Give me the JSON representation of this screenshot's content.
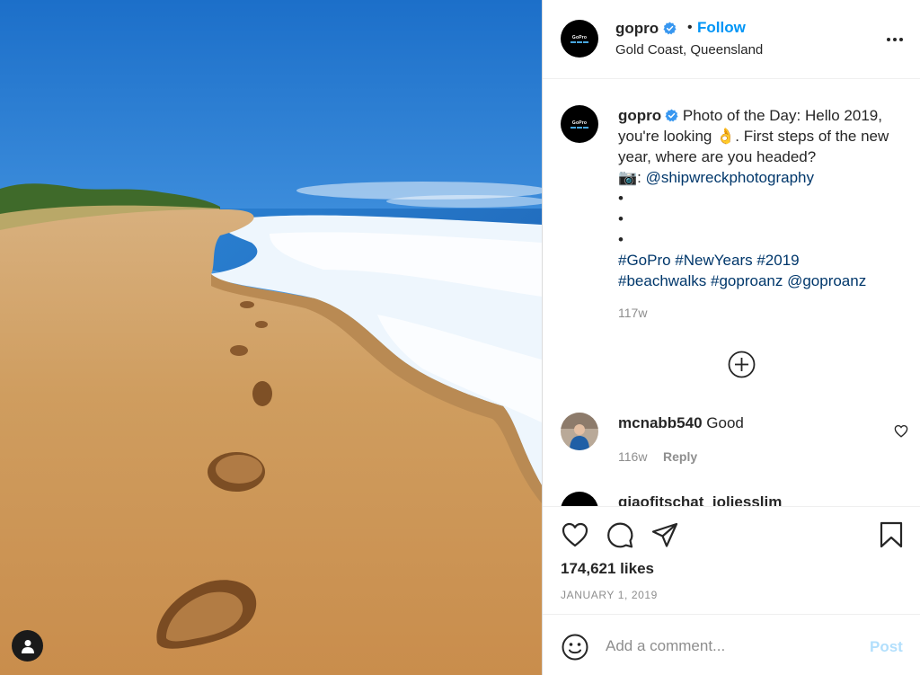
{
  "post": {
    "username": "gopro",
    "logo_text": "GoPro",
    "separator": "•",
    "follow_label": "Follow",
    "location": "Gold Coast, Queensland"
  },
  "caption": {
    "username": "gopro",
    "text_part1": " Photo of the Day: Hello 2019, you're looking 👌. First steps of the new year, where are you headed?",
    "camera_emoji": "📷",
    "colon": ": ",
    "mention_photographer": "@shipwreckphotography",
    "bullet1": "•",
    "bullet2": "•",
    "bullet3": "•",
    "tags_line1": "#GoPro #NewYears #2019",
    "tags_line2": "#beachwalks #goproanz @goproanz",
    "age": "117w"
  },
  "comments": [
    {
      "username": "mcnabb540",
      "text": "Good",
      "age": "116w",
      "reply_label": "Reply"
    },
    {
      "username": "giaofitschat_ioliesslim"
    }
  ],
  "stats": {
    "likes": "174,621 likes",
    "date": "JANUARY 1, 2019"
  },
  "composer": {
    "placeholder": "Add a comment...",
    "post_label": "Post"
  },
  "icons": {
    "verified": "verified-badge-icon",
    "more": "more-options-icon",
    "load_more": "plus-circle-icon",
    "like": "heart-icon",
    "comment": "comment-bubble-icon",
    "share": "paper-plane-icon",
    "save": "bookmark-icon",
    "emoji": "smiley-icon",
    "tagged": "user-icon"
  },
  "colors": {
    "accent": "#0095f6",
    "link": "#00376b",
    "muted": "#8e8e8e",
    "post_disabled": "#b2dffc"
  }
}
